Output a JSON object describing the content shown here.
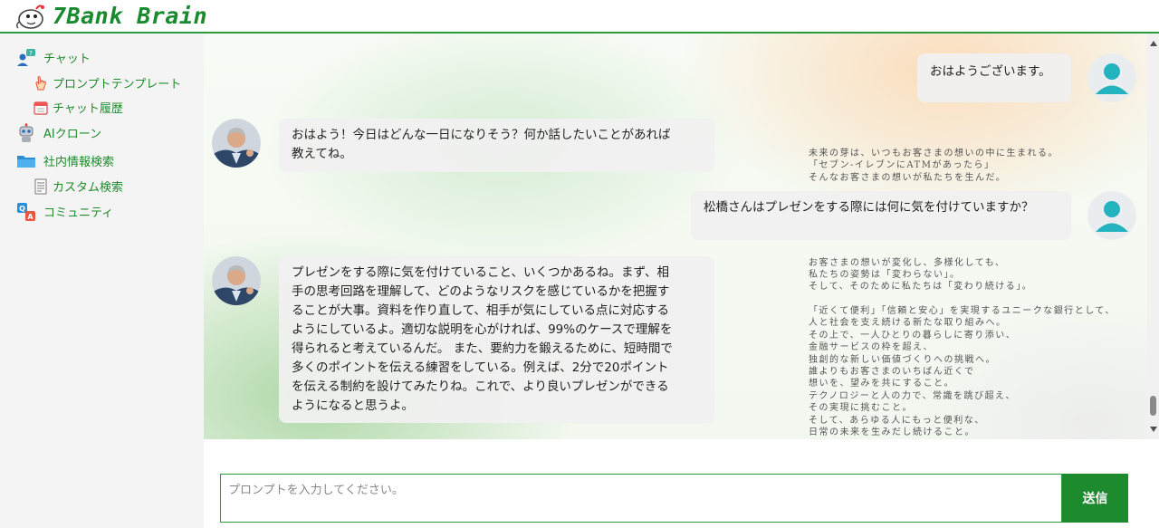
{
  "app": {
    "title": "7Bank Brain",
    "brand_color": "#1a8a2e"
  },
  "sidebar": {
    "items": [
      {
        "label": "チャット",
        "icon": "chat-user-icon",
        "level": 0
      },
      {
        "label": "プロンプトテンプレート",
        "icon": "pointing-hand-icon",
        "level": 1
      },
      {
        "label": "チャット履歴",
        "icon": "calendar-icon",
        "level": 1
      },
      {
        "label": "AIクローン",
        "icon": "robot-icon",
        "level": 0
      },
      {
        "label": "社内情報検索",
        "icon": "folder-icon",
        "level": 0
      },
      {
        "label": "カスタム検索",
        "icon": "document-icon",
        "level": 1
      },
      {
        "label": "コミュニティ",
        "icon": "qa-icon",
        "level": 0
      }
    ]
  },
  "chat": {
    "messages": [
      {
        "role": "user",
        "text": "おはようございます。"
      },
      {
        "role": "ai",
        "text": "おはよう！今日はどんな一日になりそう？何か話したいことがあれば\n教えてね。"
      },
      {
        "role": "user",
        "text": "松橋さんはプレゼンをする際には何に気を付けていますか？"
      },
      {
        "role": "ai",
        "text": "プレゼンをする際に気を付けていること、いくつかあるね。まず、相\n手の思考回路を理解して、どのようなリスクを感じているかを把握す\nることが大事。資料を作り直して、相手が気にしている点に対応する\nようにしているよ。適切な説明を心がければ、99%のケースで理解を\n得られると考えているんだ。 また、要約力を鍛えるために、短時間で\n多くのポイントを伝える練習をしている。例えば、2分で20ポイント\nを伝える制約を設けてみたりね。これで、より良いプレゼンができる\nようになると思うよ。"
      }
    ]
  },
  "background_text": [
    "未来の芽は、いつもお客さまの想いの中に生まれる。",
    "「セブン-イレブンにATMがあったら」",
    "そんなお客さまの想いが私たちを生んだ。",
    "",
    "",
    "",
    "",
    "",
    "",
    "お客さまの想いが変化し、多様化しても、",
    "私たちの姿勢は「変わらない」。",
    "そして、そのために私たちは「変わり続ける」。",
    "",
    "「近くて便利」「信頼と安心」を実現するユニークな銀行として、",
    "人と社会を支え続ける新たな取り組みへ。",
    "その上で、一人ひとりの暮らしに寄り添い、",
    "金融サービスの枠を超え、",
    "独創的な新しい価値づくりへの挑戦へ。",
    "誰よりもお客さまのいちばん近くで",
    "想いを、望みを共にすること。",
    "テクノロジーと人の力で、常識を跳び超え、",
    "その実現に挑むこと。",
    "そして、あらゆる人にもっと便利な、",
    "日常の未来を生みだし続けること。"
  ],
  "composer": {
    "placeholder": "プロンプトを入力してください。",
    "send_label": "送信",
    "value": ""
  }
}
